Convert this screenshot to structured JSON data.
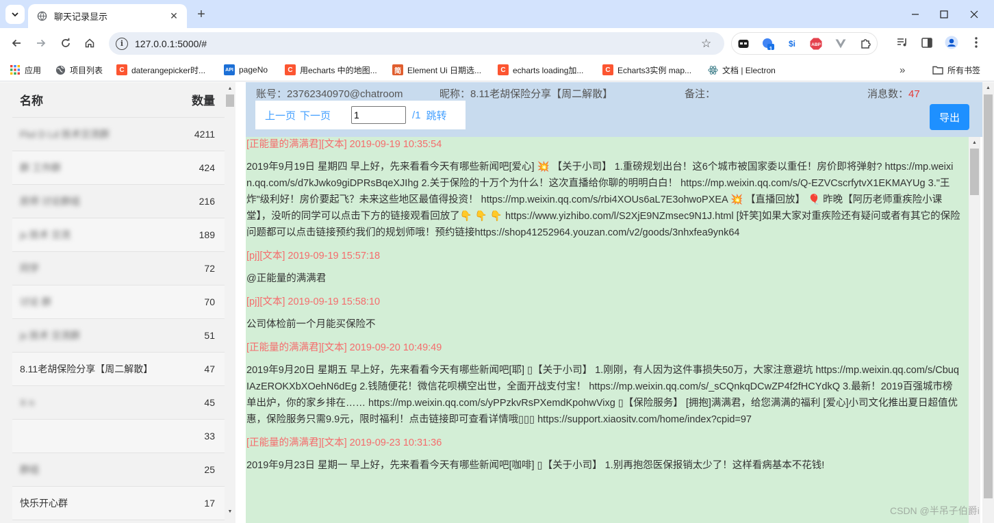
{
  "browser": {
    "tab_title": "聊天记录显示",
    "url": "127.0.0.1:5000/#",
    "ext_badge": "1",
    "ext_si": "$i",
    "ext_abp": "ABP"
  },
  "bookmarks": [
    {
      "label": "应用",
      "icon": "apps-grid-icon"
    },
    {
      "label": "项目列表",
      "icon": "globe-icon"
    },
    {
      "label": "daterangepicker时...",
      "icon": "csdn-icon"
    },
    {
      "label": "pageNo",
      "icon": "api-icon"
    },
    {
      "label": "用echarts 中的地图...",
      "icon": "csdn-icon"
    },
    {
      "label": "Element Ui 日期选...",
      "icon": "jianshu-icon"
    },
    {
      "label": "echarts loading加...",
      "icon": "csdn-icon"
    },
    {
      "label": "Echarts3实例 map...",
      "icon": "csdn-icon"
    },
    {
      "label": "文档 | Electron",
      "icon": "electron-icon"
    }
  ],
  "bookmarks_all": "所有书签",
  "sidebar": {
    "col_name": "名称",
    "col_count": "数量",
    "items": [
      {
        "name": "Flut        D    Ld  技术交流群",
        "count": "4211",
        "blurred": true
      },
      {
        "name": "     群        工作群",
        "count": "424",
        "blurred": true
      },
      {
        "name": "房师    讨论群组",
        "count": "216",
        "blurred": true
      },
      {
        "name": "js   技术    交流",
        "count": "189",
        "blurred": true
      },
      {
        "name": "同学",
        "count": "72",
        "blurred": true
      },
      {
        "name": "    讨论     群",
        "count": "70",
        "blurred": true
      },
      {
        "name": "js   技术    交流群",
        "count": "51",
        "blurred": true
      },
      {
        "name": "8.11老胡保险分享【周二解散】",
        "count": "47",
        "blurred": false
      },
      {
        "name": "X       n",
        "count": "45",
        "blurred": true
      },
      {
        "name": "          ",
        "count": "33",
        "blurred": true
      },
      {
        "name": "         群组",
        "count": "25",
        "blurred": true
      },
      {
        "name": "快乐开心群",
        "count": "17",
        "blurred": false
      }
    ]
  },
  "chat": {
    "account_label": "账号：",
    "account": "23762340970@chatroom",
    "nickname_label": "昵称：",
    "nickname": "8.11老胡保险分享【周二解散】",
    "remark_label": "备注：",
    "count_label": "消息数：",
    "count": "47",
    "prev_page": "上一页",
    "next_page": "下一页",
    "page_input": "1",
    "page_total": "/1",
    "jump": "跳转",
    "export": "导出"
  },
  "messages": [
    {
      "head": "[正能量的满满君][文本] 2019-09-19 10:35:54",
      "body": "2019年9月19日 星期四 早上好，先来看看今天有哪些新闻吧[爱心] 💥 【关于小司】 1.重磅规划出台！这6个城市被国家委以重任！房价即将弹射? https://mp.weixin.qq.com/s/d7kJwko9giDPRsBqeXJIhg 2.关于保险的十万个为什么！这次直播给你聊的明明白白！ https://mp.weixin.qq.com/s/Q-EZVCscrfytvX1EKMAYUg 3.\"王炸\"级利好！房价要起飞？未来这些地区最值得投资！ https://mp.weixin.qq.com/s/rbi4XOUs6aL7E3ohwoPXEA 💥 【直播回放】 🎈 昨晚【阿历老师重疾险小课堂】，没听的同学可以点击下方的链接观看回放了👇 👇 👇 https://www.yizhibo.com/l/S2XjE9NZmsec9N1J.html [奸笑]如果大家对重疾险还有疑问或者有其它的保险问题都可以点击链接预约我们的规划师哦！预约链接https://shop41252964.youzan.com/v2/goods/3nhxfea9ynk64"
    },
    {
      "head": "[pj][文本] 2019-09-19 15:57:18",
      "body": "@正能量的满满君"
    },
    {
      "head": "[pj][文本] 2019-09-19 15:58:10",
      "body": "公司体检前一个月能买保险不"
    },
    {
      "head": "[正能量的满满君][文本] 2019-09-20 10:49:49",
      "body": "2019年9月20日 星期五 早上好，先来看看今天有哪些新闻吧[耶] ▯【关于小司】 1.刚刚，有人因为这件事损失50万，大家注意避坑 https://mp.weixin.qq.com/s/CbuqIAzEROKXbXOehN6dEg 2.钱随便花！微信花呗横空出世，全面开战支付宝！ https://mp.weixin.qq.com/s/_sCQnkqDCwZP4f2fHCYdkQ 3.最新！2019百强城市榜单出炉，你的家乡排在…… https://mp.weixin.qq.com/s/yPPzkvRsPXemdKpohwVixg ▯【保险服务】 [拥抱]满满君，给您满满的福利 [爱心]小司文化推出夏日超值优惠，保险服务只需9.9元，限时福利！点击链接即可查看详情哦▯▯▯ https://support.xiaositv.com/home/index?cpid=97"
    },
    {
      "head": "[正能量的满满君][文本] 2019-09-23 10:31:36",
      "body": "2019年9月23日 星期一 早上好，先来看看今天有哪些新闻吧[咖啡] ▯【关于小司】 1.别再抱怨医保报销太少了！这样看病基本不花钱!"
    }
  ],
  "watermark": "CSDN @半吊子伯爵i"
}
